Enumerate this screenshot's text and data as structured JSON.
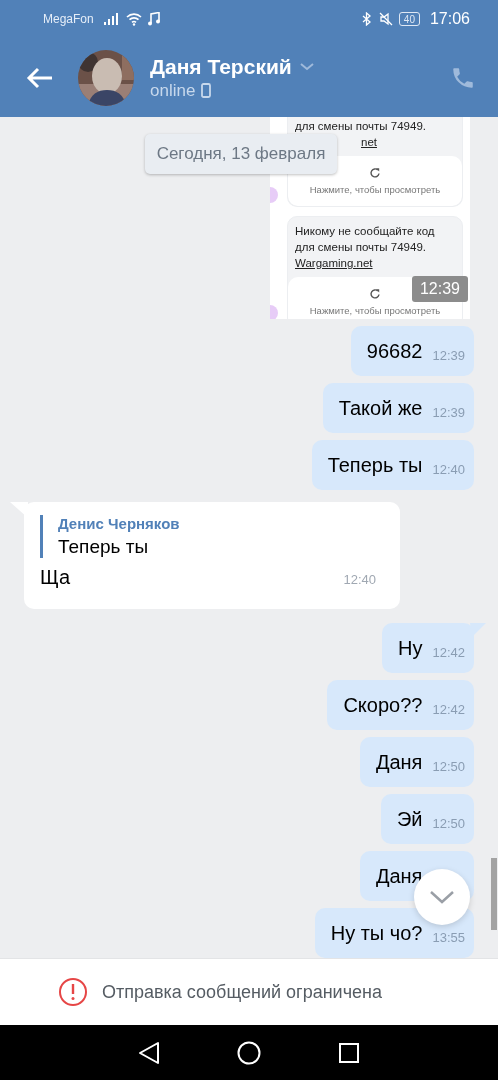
{
  "status_bar": {
    "carrier": "MegaFon",
    "battery": "40",
    "time": "17:06"
  },
  "header": {
    "name": "Даня Терский",
    "status": "online"
  },
  "date_divider": "Сегодня, 13 февраля",
  "attachment": {
    "cards": [
      {
        "lines": [
          "для смены почты 74949."
        ],
        "link": "net",
        "action": "Нажмите, чтобы просмотреть"
      },
      {
        "lines": [
          "Никому не сообщайте код",
          "для смены почты 74949."
        ],
        "link": "Wargaming.net",
        "action": "Нажмите, чтобы просмотреть"
      }
    ],
    "time": "12:39"
  },
  "messages": [
    {
      "kind": "outgoing",
      "text": "96682",
      "time": "12:39",
      "tail": false
    },
    {
      "kind": "outgoing",
      "text": "Такой же",
      "time": "12:39",
      "tail": false
    },
    {
      "kind": "outgoing",
      "text": "Теперь ты",
      "time": "12:40",
      "tail": false
    },
    {
      "kind": "incoming",
      "reply": {
        "author": "Денис Черняков",
        "text": "Теперь ты"
      },
      "text": "Ща",
      "time": "12:40",
      "tail": true
    },
    {
      "kind": "outgoing",
      "text": "Ну",
      "time": "12:42",
      "tail": true
    },
    {
      "kind": "outgoing",
      "text": "Скоро??",
      "time": "12:42",
      "tail": false
    },
    {
      "kind": "outgoing",
      "text": "Даня",
      "time": "12:50",
      "tail": false
    },
    {
      "kind": "outgoing",
      "text": "Эй",
      "time": "12:50",
      "tail": false
    },
    {
      "kind": "outgoing",
      "text": "Даня",
      "tail": false
    },
    {
      "kind": "outgoing",
      "text": "Ну ты чо?",
      "time": "13:55",
      "tail": false
    }
  ],
  "footer": {
    "notice": "Отправка сообщений ограничена"
  }
}
